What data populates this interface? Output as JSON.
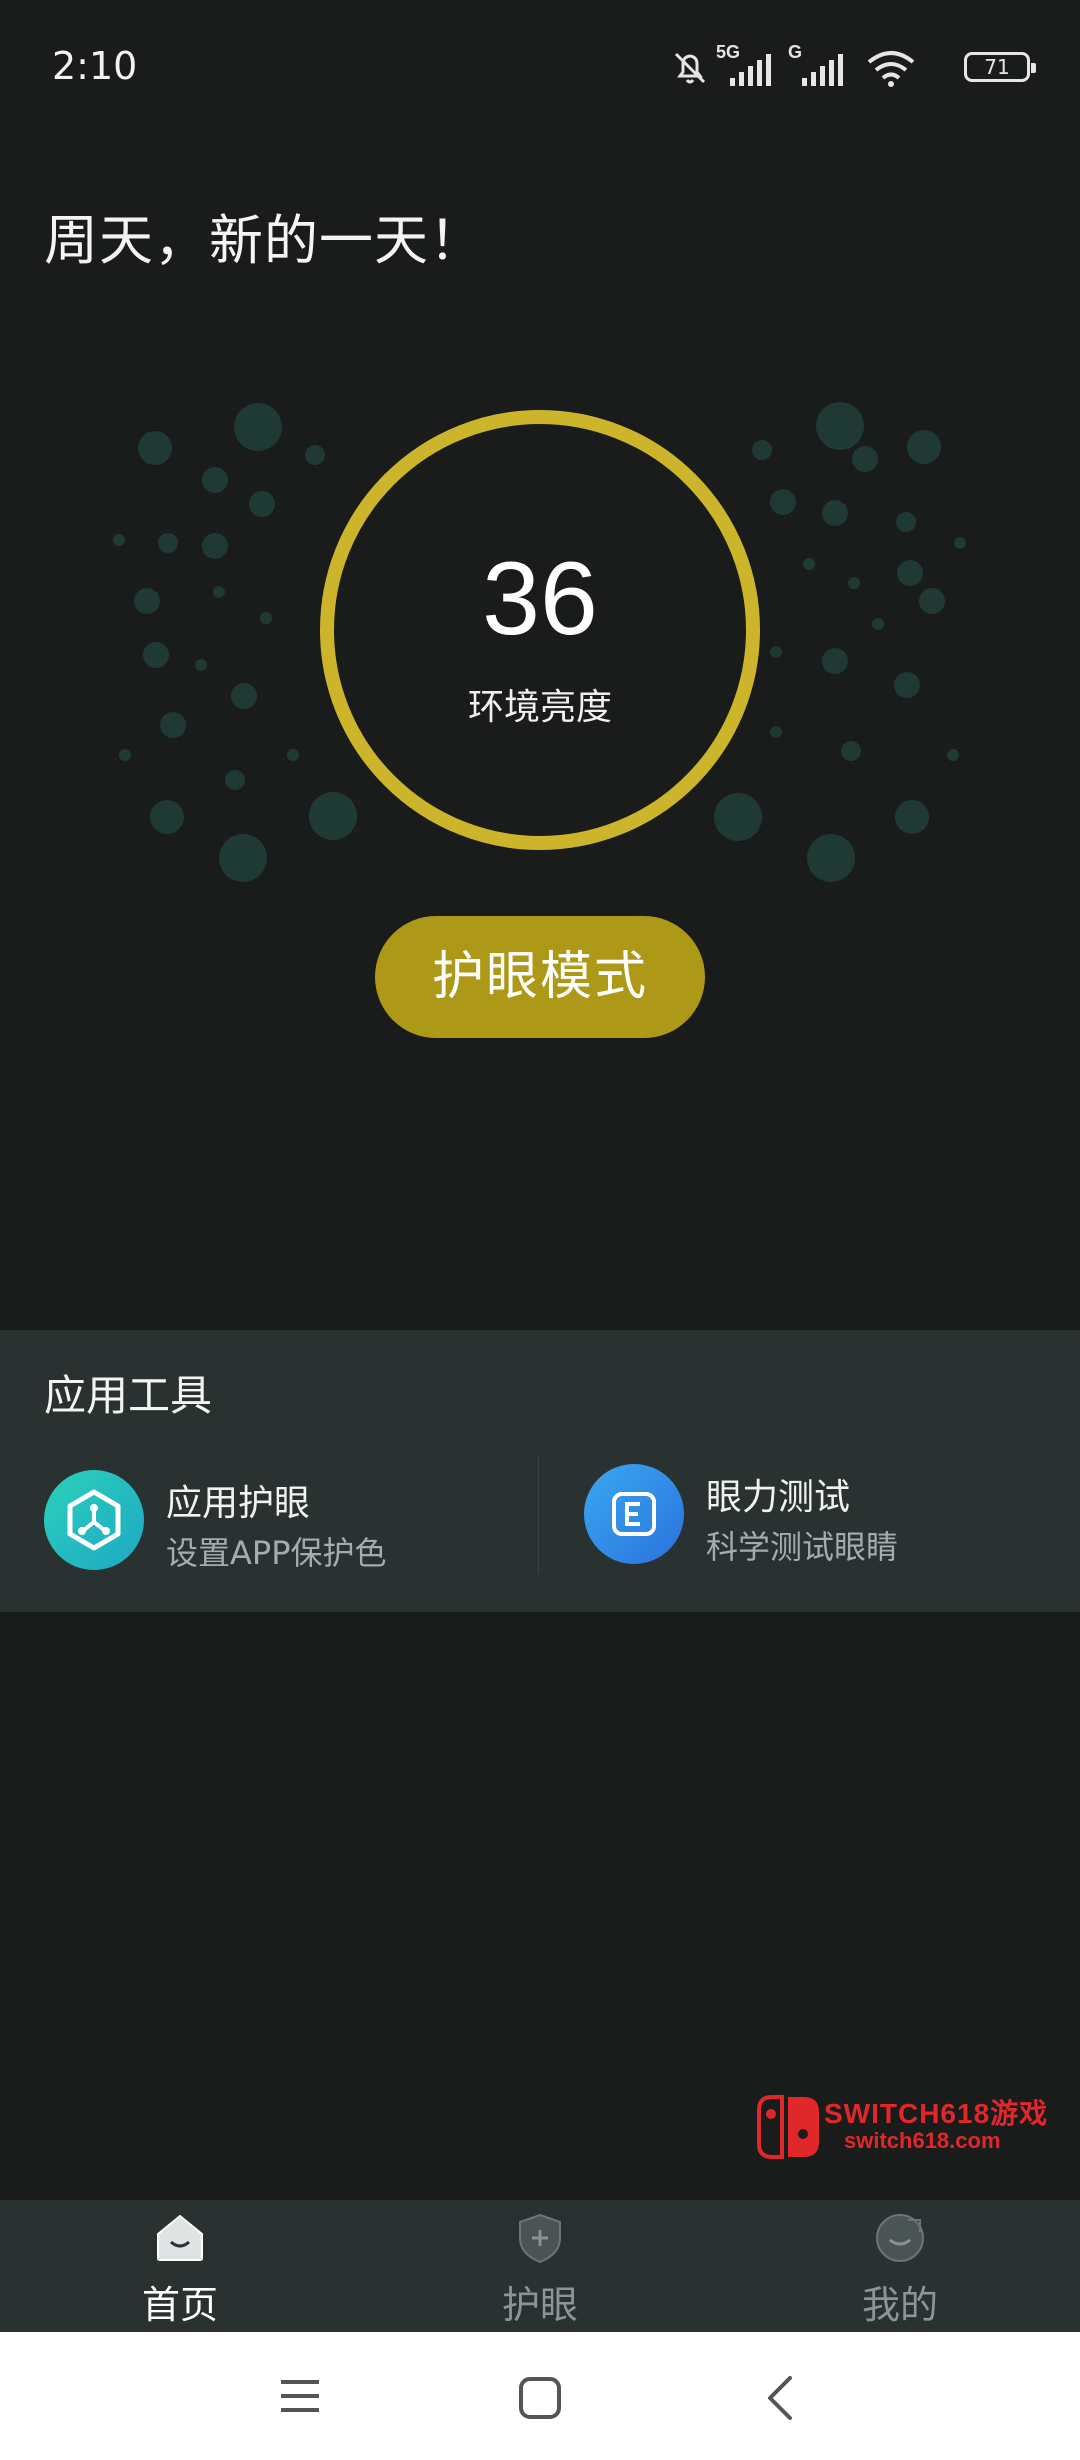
{
  "status_bar": {
    "time": "2:10",
    "network_1": "5G",
    "network_2": "G",
    "battery": "71"
  },
  "greeting": "周天，新的一天！",
  "brightness": {
    "value": "36",
    "label": "环境亮度",
    "ring_color": "#cdb52b"
  },
  "eye_mode_button": "护眼模式",
  "tools": {
    "title": "应用工具",
    "items": [
      {
        "title": "应用护眼",
        "subtitle": "设置APP保护色",
        "icon": "hexagon-icon",
        "color": "#22c1b4"
      },
      {
        "title": "眼力测试",
        "subtitle": "科学测试眼睛",
        "icon": "e-chart-icon",
        "color": "#2e8fe8"
      }
    ]
  },
  "watermark": {
    "title": "SWITCH618游戏",
    "url": "switch618.com"
  },
  "bottom_nav": {
    "items": [
      {
        "label": "首页",
        "icon": "home-icon",
        "active": true
      },
      {
        "label": "护眼",
        "icon": "shield-plus-icon",
        "active": false
      },
      {
        "label": "我的",
        "icon": "profile-icon",
        "active": false
      }
    ]
  },
  "colors": {
    "background": "#1a1b1b",
    "panel": "#2a3131",
    "accent": "#ad9817",
    "dots": "#1f3a35"
  }
}
